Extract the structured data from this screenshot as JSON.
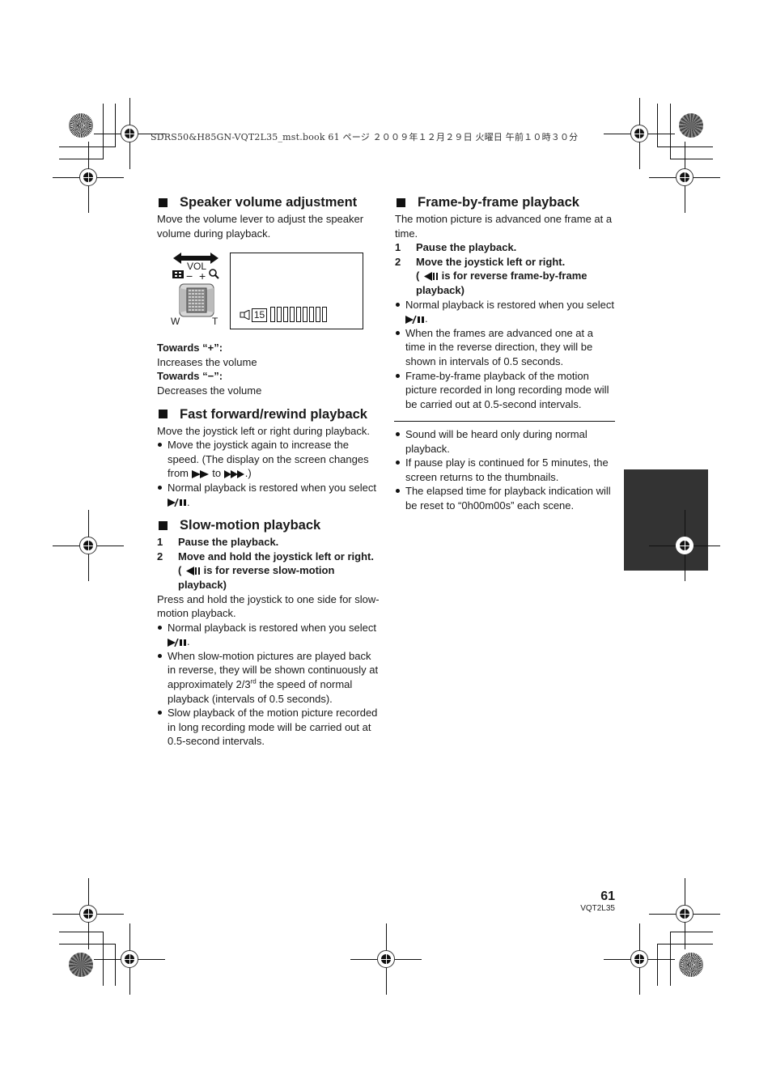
{
  "header": {
    "print_info": "SDRS50&H85GN-VQT2L35_mst.book  61 ページ  ２００９年１２月２９日  火曜日  午前１０時３０分"
  },
  "left_column": {
    "speaker": {
      "title": "Speaker volume adjustment",
      "intro": "Move the volume lever to adjust the speaker volume during playback.",
      "diagram": {
        "lever_label": "VOL",
        "minus": "−",
        "plus": "+",
        "w_label": "W",
        "t_label": "T",
        "volume_value": "15",
        "volume_bars": 9,
        "icons": [
          "double-arrow-icon",
          "thumbnail-icon",
          "zoom-magnifier-icon",
          "speaker-icon"
        ]
      },
      "towards_plus_label": "Towards “+”:",
      "towards_plus_text": "Increases the volume",
      "towards_minus_label": "Towards “−”:",
      "towards_minus_text": "Decreases the volume"
    },
    "fast_forward": {
      "title": "Fast forward/rewind playback",
      "intro": "Move the joystick left or right during playback.",
      "bullet1_a": "Move the joystick again to increase the speed. (The display on the screen changes from",
      "bullet1_to": "to",
      "bullet1_end": ".)",
      "bullet2_a": "Normal playback is restored when you select",
      "bullet2_end": "."
    },
    "slow_motion": {
      "title": "Slow-motion playback",
      "step1_num": "1",
      "step1": "Pause the playback.",
      "step2_num": "2",
      "step2": "Move and hold the joystick left or right.",
      "step2_note_open": "(",
      "step2_note": "is for reverse slow-motion playback)",
      "intro": "Press and hold the joystick to one side for slow-motion playback.",
      "bullet1_a": "Normal playback is restored when you select",
      "bullet1_end": ".",
      "bullet2_a": "When slow-motion pictures are played back in reverse, they will be shown continuously at approximately 2/3",
      "bullet2_sup": "rd",
      "bullet2_b": " the speed of normal playback (intervals of 0.5 seconds).",
      "bullet3": "Slow playback of the motion picture recorded in long recording mode will be carried out at 0.5-second intervals."
    }
  },
  "right_column": {
    "frame_by_frame": {
      "title": "Frame-by-frame playback",
      "intro": "The motion picture is advanced one frame at a time.",
      "step1_num": "1",
      "step1": "Pause the playback.",
      "step2_num": "2",
      "step2": "Move the joystick left or right.",
      "step2_note_open": "(",
      "step2_note": "is for reverse frame-by-frame playback)",
      "bullet1_a": "Normal playback is restored when you select",
      "bullet1_end": ".",
      "bullet2": "When the frames are advanced one at a time in the reverse direction, they will be shown in intervals of 0.5 seconds.",
      "bullet3": "Frame-by-frame playback of the motion picture recorded in long recording mode will be carried out at 0.5-second intervals."
    },
    "notes": [
      "Sound will be heard only during normal playback.",
      "If pause play is continued for 5 minutes, the screen returns to the thumbnails.",
      "The elapsed time for playback indication will be reset to “0h00m00s” each scene."
    ]
  },
  "footer": {
    "page_number": "61",
    "model_code": "VQT2L35"
  },
  "colors": {
    "text": "#1a1a1a",
    "side_tab": "#333333"
  }
}
